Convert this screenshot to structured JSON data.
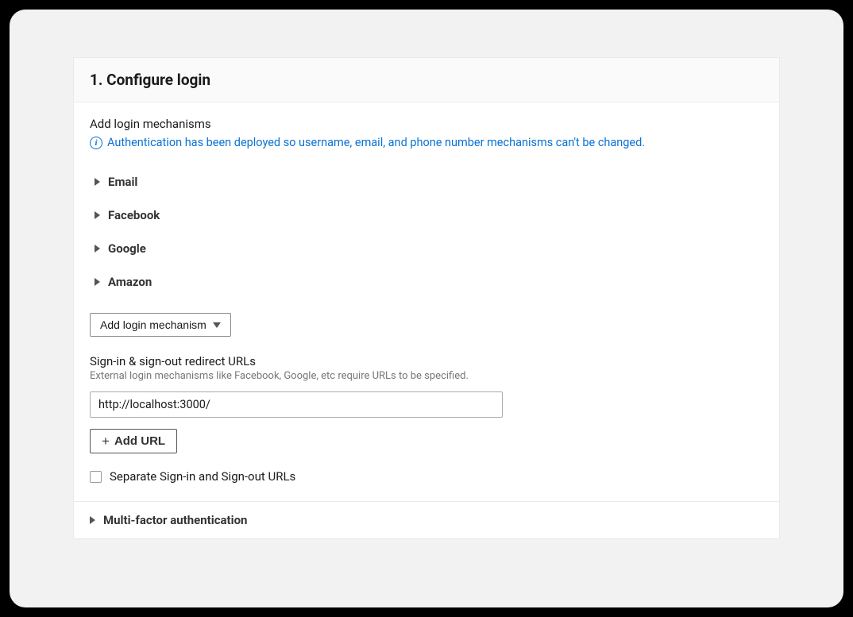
{
  "panel": {
    "title": "1. Configure login"
  },
  "login": {
    "subheading": "Add login mechanisms",
    "info_note": "Authentication has been deployed so username, email, and phone number mechanisms can't be changed.",
    "mechanisms": [
      {
        "label": "Email"
      },
      {
        "label": "Facebook"
      },
      {
        "label": "Google"
      },
      {
        "label": "Amazon"
      }
    ],
    "add_mechanism_label": "Add login mechanism"
  },
  "redirect": {
    "label": "Sign-in & sign-out redirect URLs",
    "help": "External login mechanisms like Facebook, Google, etc require URLs to be specified.",
    "url_value": "http://localhost:3000/",
    "add_url_label": "Add URL",
    "separate_label": "Separate Sign-in and Sign-out URLs"
  },
  "mfa": {
    "label": "Multi-factor authentication"
  }
}
